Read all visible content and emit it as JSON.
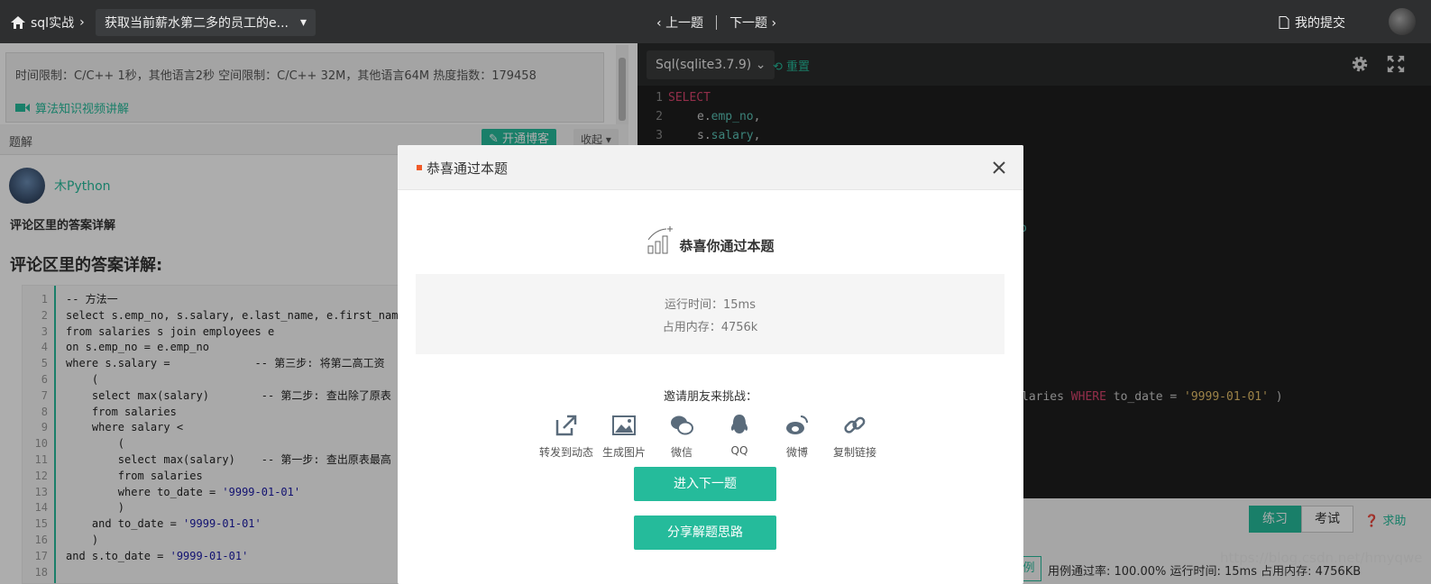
{
  "topbar": {
    "crumb": "sql实战",
    "problem_title": "获取当前薪水第二多的员工的e...",
    "prev": "上一题",
    "next": "下一题",
    "my_submission": "我的提交"
  },
  "problem": {
    "limits": "时间限制：C/C++ 1秒，其他语言2秒   空间限制：C/C++ 32M，其他语言64M   热度指数：179458",
    "video_link": "算法知识视频讲解",
    "tab_label": "题解",
    "blog_button": "开通博客",
    "fold_button": "收起"
  },
  "solution": {
    "author": "木Python",
    "summary": "评论区里的答案详解",
    "heading": "评论区里的答案详解:",
    "lines": [
      "-- 方法一",
      "select s.emp_no, s.salary, e.last_name, e.first_name",
      "from salaries s join employees e",
      "on s.emp_no = e.emp_no",
      "where s.salary =             -- 第三步: 将第二高工资",
      "    (",
      "    select max(salary)        -- 第二步: 查出除了原表",
      "    from salaries",
      "    where salary <",
      "        (",
      "        select max(salary)    -- 第一步: 查出原表最高",
      "        from salaries",
      "        where to_date = '9999-01-01'",
      "        )",
      "    and to_date = '9999-01-01'",
      "    )",
      "and s.to_date = '9999-01-01'",
      ""
    ],
    "line_numbers": [
      "1",
      "2",
      "3",
      "4",
      "5",
      "6",
      "7",
      "8",
      "9",
      "10",
      "11",
      "12",
      "13",
      "14",
      "15",
      "16",
      "17",
      "18"
    ]
  },
  "editor": {
    "language": "Sql(sqlite3.7.9)",
    "reset": "重置",
    "line1_kw": "SELECT",
    "line2_a": "e.",
    "line2_b": "emp_no",
    "line3_a": "s.",
    "line3_b": "salary",
    "frag_o": "o",
    "tail_a": "laries ",
    "tail_kw": "WHERE",
    "tail_b": " to_date = ",
    "tail_str": "'9999-01-01'",
    "tail_c": " )",
    "numbers": [
      "1",
      "2",
      "3"
    ]
  },
  "bottom": {
    "practice": "练习",
    "exam": "考试",
    "help": "求助",
    "tag": "例",
    "status": "用例通过率: 100.00%   运行时间: 15ms   占用内存: 4756KB"
  },
  "modal": {
    "title": "恭喜通过本题",
    "congrats": "恭喜你通过本题",
    "runtime": "运行时间：15ms",
    "memory": "占用内存：4756k",
    "invite": "邀请朋友来挑战：",
    "shares": [
      "转发到动态",
      "生成图片",
      "微信",
      "QQ",
      "微博",
      "复制链接"
    ],
    "next_btn": "进入下一题",
    "share_btn": "分享解题思路"
  },
  "watermark": "https://blog.csdn.net/hmyqwe",
  "colors": {
    "accent": "#25bb9b",
    "topbar": "#2e2f30",
    "editor_bg": "#1e1e1e"
  }
}
